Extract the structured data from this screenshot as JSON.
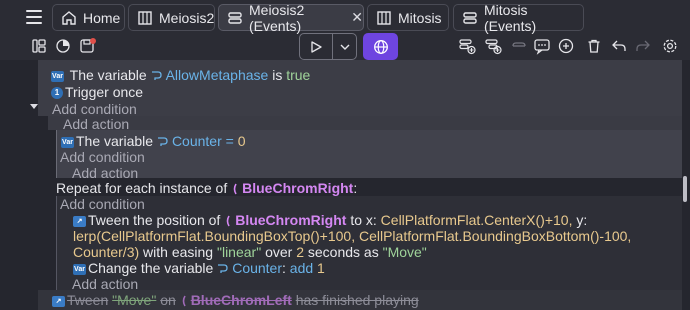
{
  "tabs": [
    {
      "label": "Home",
      "icon": "home-icon"
    },
    {
      "label": "Meiosis2",
      "icon": "scene-icon"
    },
    {
      "label": "Meiosis2 (Events)",
      "icon": "events-icon",
      "active": true
    },
    {
      "label": "Mitosis",
      "icon": "scene-icon"
    },
    {
      "label": "Mitosis (Events)",
      "icon": "events-icon"
    }
  ],
  "tab_close": "✕",
  "events": {
    "cond1": {
      "pre": "The variable",
      "var": "AllowMetaphase",
      "mid": "is",
      "value": "true"
    },
    "cond2": "Trigger once",
    "add_condition": "Add condition",
    "add_action": "Add action",
    "act1": {
      "pre": "The variable",
      "var": "Counter",
      "op": "=",
      "value": "0"
    },
    "repeat": {
      "pre": "Repeat for each instance of",
      "obj": "BlueChromRight",
      "post": ":"
    },
    "tween": {
      "pre": "Tween the position of",
      "obj": "BlueChromRight",
      "to": "to x:",
      "x_expr": "CellPlatformFlat.CenterX()+10,",
      "y": "y:",
      "line2": "lerp(CellPlatformFlat.BoundingBoxTop()+100, CellPlatformFlat.BoundingBoxBottom()-100,",
      "line3a": "Counter/3)",
      "easing_pre": "with easing",
      "easing": "\"linear\"",
      "over": "over",
      "seconds_val": "2",
      "seconds": "seconds as",
      "name": "\"Move\""
    },
    "change": {
      "pre": "Change the variable",
      "var": "Counter",
      "colon": ":",
      "op": "add",
      "value": "1"
    },
    "last": {
      "pre": "Tween",
      "name": "\"Move\"",
      "on": "on",
      "obj": "BlueChromLeft",
      "post": "has finished playing"
    }
  },
  "colors": {
    "accent": "#6e45e0",
    "variable": "#6ab3e8",
    "object": "#d487f2",
    "string": "#9fd39a",
    "number": "#e8c98e"
  }
}
